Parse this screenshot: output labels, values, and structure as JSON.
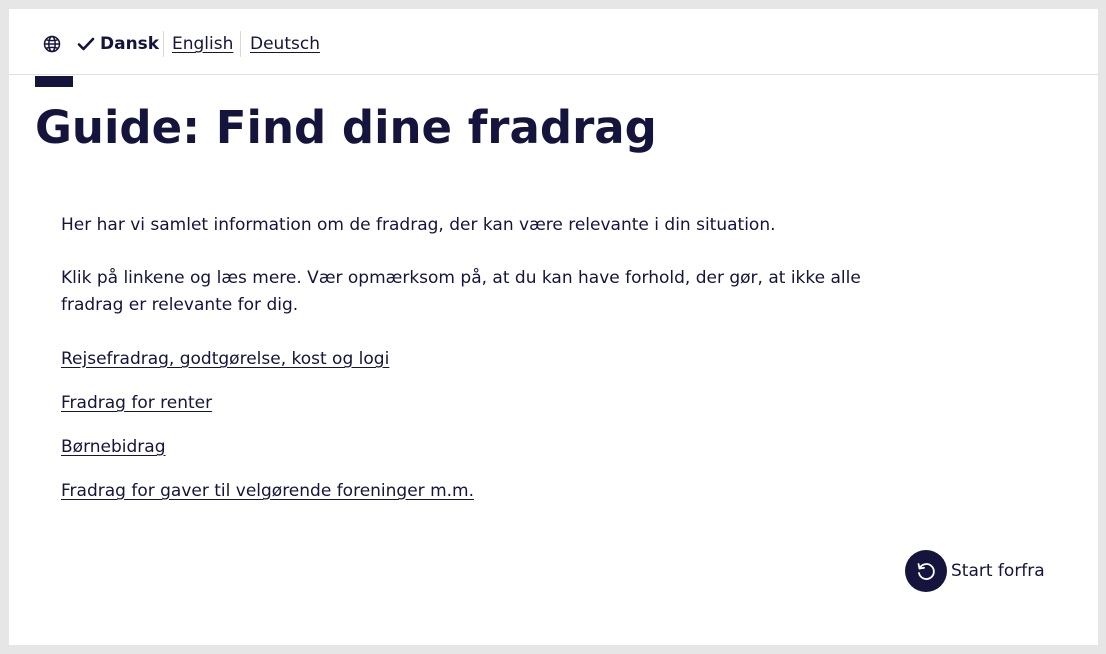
{
  "language_bar": {
    "current_language": "Dansk",
    "options": [
      {
        "label": "English"
      },
      {
        "label": "Deutsch"
      }
    ],
    "icon": "globe-icon"
  },
  "page": {
    "title": "Guide: Find dine fradrag",
    "intro": "Her har vi samlet information om de fradrag, der kan være relevante i din situation.",
    "note": "Klik på linkene og læs mere. Vær opmærksom på, at du kan have forhold, der gør, at ikke alle fradrag er relevante for dig.",
    "links": [
      {
        "label": "Rejsefradrag, godtgørelse, kost og logi"
      },
      {
        "label": "Fradrag for renter"
      },
      {
        "label": "Børnebidrag"
      },
      {
        "label": "Fradrag for gaver til velgørende foreninger m.m."
      }
    ]
  },
  "restart": {
    "label": "Start forfra",
    "icon": "restart-icon"
  },
  "colors": {
    "primary": "#14143c",
    "background": "#ffffff",
    "frame": "#e6e6e6"
  }
}
